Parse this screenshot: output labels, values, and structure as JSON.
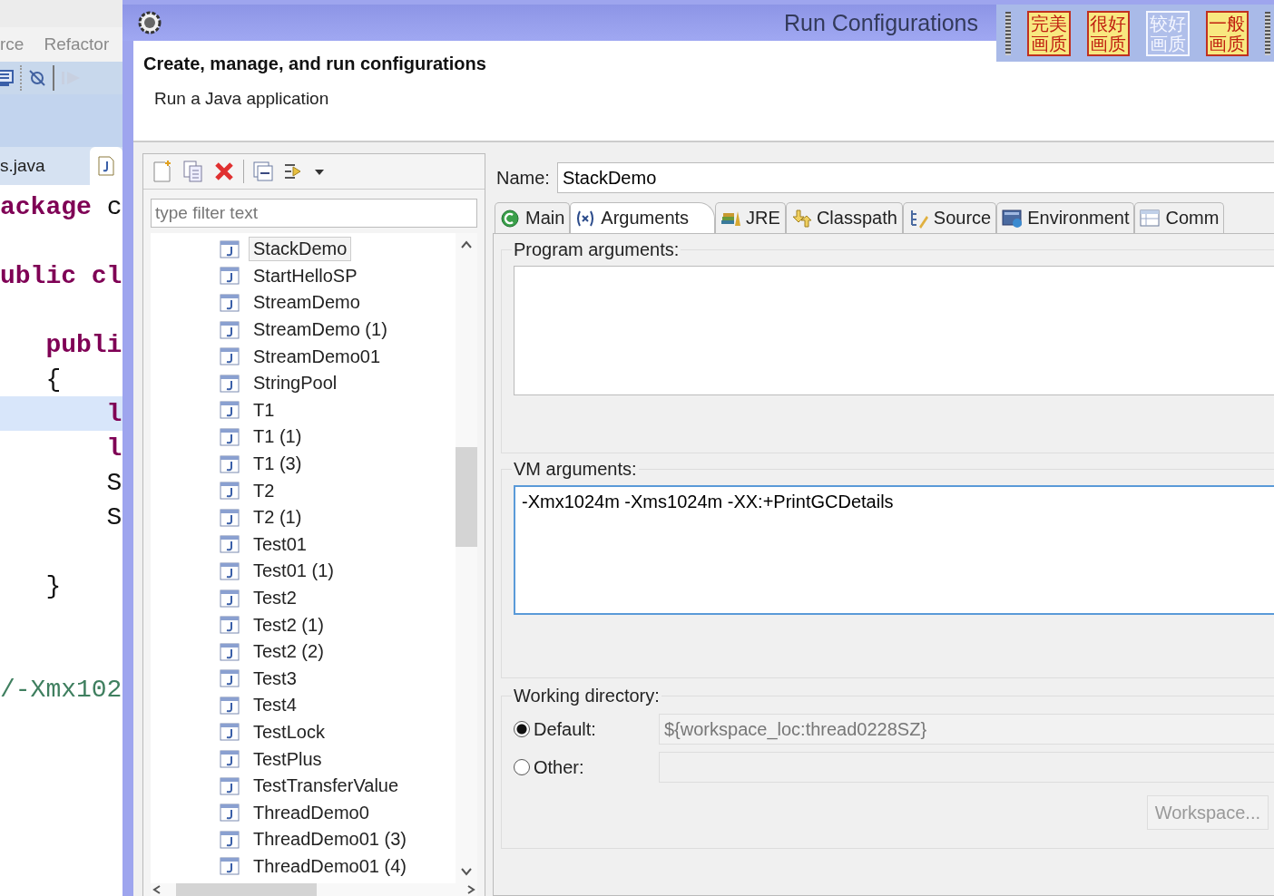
{
  "ide": {
    "menu": [
      "rce",
      "Refactor"
    ],
    "editor_tab": "s.java",
    "code_lines": [
      {
        "kind": "code",
        "current": false,
        "segments": [
          {
            "text": "ackage",
            "kind": "keyword"
          },
          {
            "text": " c",
            "kind": "plain"
          }
        ]
      },
      {
        "kind": "blank"
      },
      {
        "kind": "code",
        "current": false,
        "segments": [
          {
            "text": "ublic cl",
            "kind": "keyword"
          }
        ]
      },
      {
        "kind": "blank"
      },
      {
        "kind": "code",
        "current": false,
        "segments": [
          {
            "text": "   publi",
            "kind": "keyword"
          }
        ]
      },
      {
        "kind": "code",
        "current": false,
        "segments": [
          {
            "text": "   {",
            "kind": "plain"
          }
        ]
      },
      {
        "kind": "code",
        "current": true,
        "segments": [
          {
            "text": "       l",
            "kind": "keyword"
          }
        ]
      },
      {
        "kind": "code",
        "current": false,
        "segments": [
          {
            "text": "       l",
            "kind": "keyword"
          }
        ]
      },
      {
        "kind": "code",
        "current": false,
        "segments": [
          {
            "text": "       S",
            "kind": "plain"
          }
        ]
      },
      {
        "kind": "code",
        "current": false,
        "segments": [
          {
            "text": "       S",
            "kind": "plain"
          }
        ]
      },
      {
        "kind": "blank"
      },
      {
        "kind": "code",
        "current": false,
        "segments": [
          {
            "text": "   }",
            "kind": "plain"
          }
        ]
      },
      {
        "kind": "blank"
      },
      {
        "kind": "blank"
      },
      {
        "kind": "code",
        "current": false,
        "segments": [
          {
            "text": "/-Xmx102",
            "kind": "comment"
          }
        ]
      }
    ]
  },
  "window": {
    "title": "Run Configurations"
  },
  "quality_buttons": [
    {
      "label": "完美画质",
      "selected": false
    },
    {
      "label": "很好画质",
      "selected": false
    },
    {
      "label": "较好画质",
      "selected": true
    },
    {
      "label": "一般画质",
      "selected": false
    }
  ],
  "header": {
    "title": "Create, manage, and run configurations",
    "subtitle": "Run a Java application"
  },
  "config_list": {
    "filter": {
      "placeholder": "type filter text"
    },
    "items": [
      {
        "label": "StackDemo",
        "selected": true
      },
      {
        "label": "StartHelloSP",
        "selected": false
      },
      {
        "label": "StreamDemo",
        "selected": false
      },
      {
        "label": "StreamDemo (1)",
        "selected": false
      },
      {
        "label": "StreamDemo01",
        "selected": false
      },
      {
        "label": "StringPool",
        "selected": false
      },
      {
        "label": "T1",
        "selected": false
      },
      {
        "label": "T1 (1)",
        "selected": false
      },
      {
        "label": "T1 (3)",
        "selected": false
      },
      {
        "label": "T2",
        "selected": false
      },
      {
        "label": "T2 (1)",
        "selected": false
      },
      {
        "label": "Test01",
        "selected": false
      },
      {
        "label": "Test01 (1)",
        "selected": false
      },
      {
        "label": "Test2",
        "selected": false
      },
      {
        "label": "Test2 (1)",
        "selected": false
      },
      {
        "label": "Test2 (2)",
        "selected": false
      },
      {
        "label": "Test3",
        "selected": false
      },
      {
        "label": "Test4",
        "selected": false
      },
      {
        "label": "TestLock",
        "selected": false
      },
      {
        "label": "TestPlus",
        "selected": false
      },
      {
        "label": "TestTransferValue",
        "selected": false
      },
      {
        "label": "ThreadDemo0",
        "selected": false
      },
      {
        "label": "ThreadDemo01 (3)",
        "selected": false
      },
      {
        "label": "ThreadDemo01 (4)",
        "selected": false
      }
    ]
  },
  "editor": {
    "name_label": "Name:",
    "name_value": "StackDemo",
    "tabs": [
      {
        "label": "Main",
        "kind": "main",
        "selected": false
      },
      {
        "label": "Arguments",
        "kind": "arguments",
        "selected": true
      },
      {
        "label": "JRE",
        "kind": "jre",
        "selected": false
      },
      {
        "label": "Classpath",
        "kind": "classpath",
        "selected": false
      },
      {
        "label": "Source",
        "kind": "source",
        "selected": false
      },
      {
        "label": "Environment",
        "kind": "environment",
        "selected": false
      },
      {
        "label": "Comm",
        "kind": "common",
        "selected": false
      }
    ],
    "program_arguments": {
      "label": "Program arguments:"
    },
    "vm_arguments": {
      "label": "VM arguments:",
      "value": "-Xmx1024m -Xms1024m -XX:+PrintGCDetails"
    },
    "working_directory": {
      "label": "Working directory:",
      "options": [
        {
          "label": "Default:",
          "selected": true,
          "value": "${workspace_loc:thread0228SZ}"
        },
        {
          "label": "Other:",
          "selected": false
        }
      ],
      "workspace_button": {
        "label": "Workspace...",
        "disabled": true
      }
    }
  }
}
